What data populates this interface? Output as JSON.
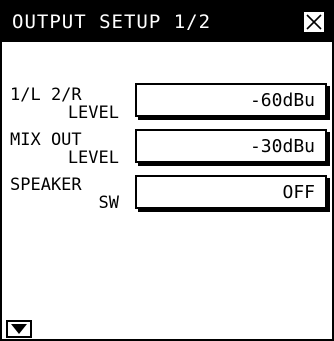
{
  "window": {
    "title": "OUTPUT SETUP 1/2",
    "close_icon": "close-x-icon"
  },
  "rows": [
    {
      "label_line1": "1/L 2/R",
      "label_line2": "LEVEL",
      "value": "-60dBu"
    },
    {
      "label_line1": "MIX OUT",
      "label_line2": "LEVEL",
      "value": "-30dBu"
    },
    {
      "label_line1": "SPEAKER",
      "label_line2": "SW",
      "value": "OFF"
    }
  ],
  "footer": {
    "scroll_icon": "triangle-down-icon"
  },
  "colors": {
    "titlebar": "#000000",
    "title_text": "#ffffff",
    "background": "#ffffff"
  }
}
